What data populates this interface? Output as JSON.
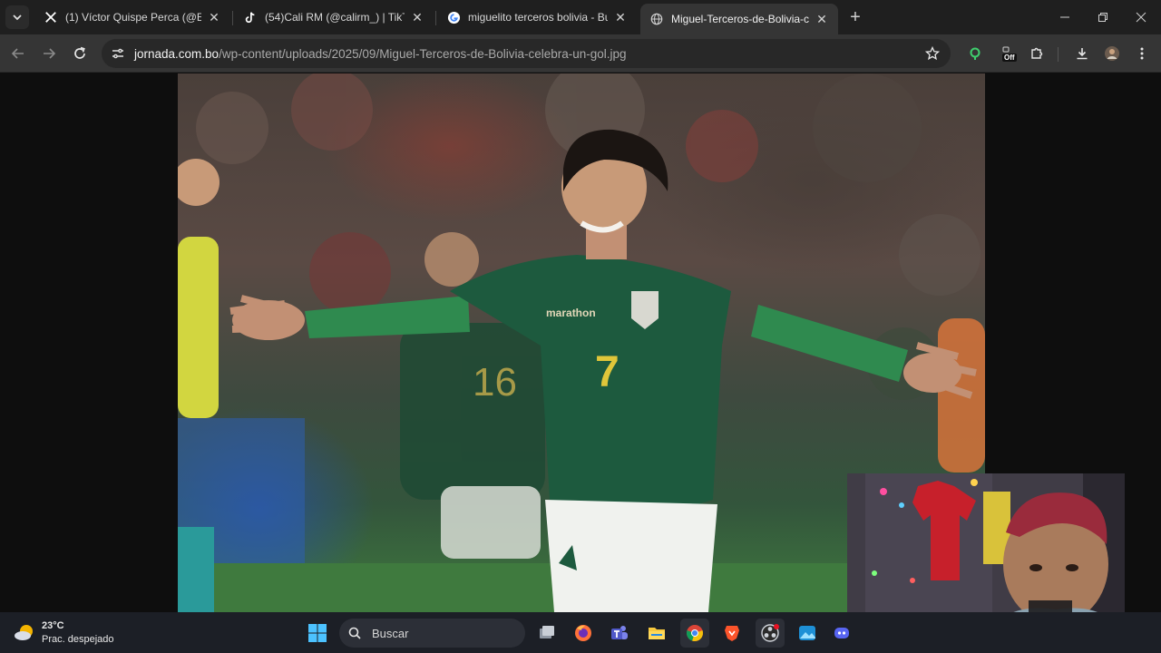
{
  "browser": {
    "tabs": [
      {
        "title": "(1) Víctor Quispe Perca (@Estad",
        "favicon": "x-logo-icon",
        "active": false
      },
      {
        "title": "(54)Cali RM (@calirm_) | TikTok",
        "favicon": "tiktok-icon",
        "active": false
      },
      {
        "title": "miguelito terceros bolivia - Bus",
        "favicon": "google-icon",
        "active": false
      },
      {
        "title": "Miguel-Terceros-de-Bolivia-cele",
        "favicon": "globe-icon",
        "active": true
      }
    ],
    "close_glyph": "✕",
    "new_tab_glyph": "+",
    "address": {
      "host": "jornada.com.bo",
      "path": "/wp-content/uploads/2025/09/Miguel-Terceros-de-Bolivia-celebra-un-gol.jpg"
    },
    "extension_badge": "Off"
  },
  "photo": {
    "jersey_sponsor": "marathon",
    "jersey_number": "7",
    "background_player_number": "16"
  },
  "taskbar": {
    "weather": {
      "temperature": "23°C",
      "condition": "Prac. despejado"
    },
    "search_placeholder": "Buscar"
  },
  "colors": {
    "jersey_green": "#1d5a3e",
    "sleeve_green": "#2f8a4f",
    "number_yellow": "#e0c63a",
    "pitch_green": "#3f7a3e"
  }
}
